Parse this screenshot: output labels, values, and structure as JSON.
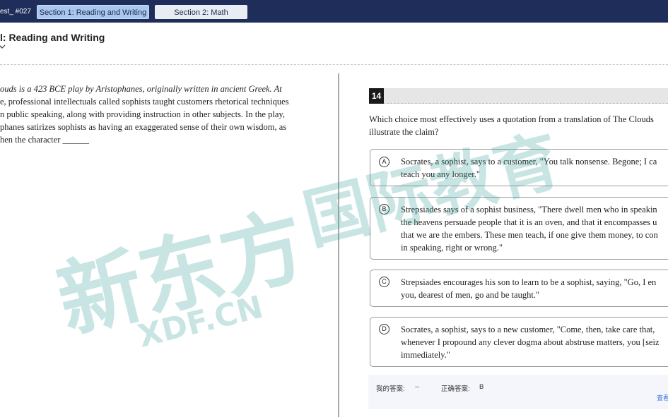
{
  "topbar": {
    "test_title": "est_ #027",
    "tabs": [
      {
        "label": "Section 1: Reading and Writing",
        "active": true
      },
      {
        "label": "Section 2: Math",
        "active": false
      }
    ]
  },
  "header": {
    "section_title": "l: Reading and Writing"
  },
  "passage": {
    "lines": [
      "ouds is a 423 BCE play by Aristophanes, originally written in ancient Greek. At",
      "e, professional intellectuals called sophists taught customers rhetorical techniques",
      "n public speaking, along with providing instruction in other subjects. In the play,",
      "phanes satirizes sophists as having an exaggerated sense of their own wisdom, as",
      "hen the character ______"
    ]
  },
  "question": {
    "number": "14",
    "lines": [
      "Which choice most effectively uses a quotation from a translation of The Clouds",
      "illustrate the claim?"
    ]
  },
  "choices": [
    {
      "letter": "A",
      "lines": [
        "Socrates, a sophist, says to a customer, \"You talk nonsense. Begone; I ca",
        "teach you any longer.\""
      ]
    },
    {
      "letter": "B",
      "lines": [
        "Strepsiades says of a sophist business, \"There dwell men who in speakin",
        "the heavens persuade people that it is an oven, and that it encompasses u",
        "that we are the embers. These men teach, if one give them money, to con",
        "in speaking, right or wrong.\""
      ]
    },
    {
      "letter": "C",
      "lines": [
        "Strepsiades encourages his son to learn to be a sophist, saying, \"Go, I en",
        "you, dearest of men, go and be taught.\""
      ]
    },
    {
      "letter": "D",
      "lines": [
        "Socrates, a sophist, says to a new customer, \"Come, then, take care that,",
        "whenever I propound any clever dogma about abstruse matters, you [seiz",
        "immediately.\""
      ]
    }
  ],
  "answer_bar": {
    "my_answer_label": "我的答案:",
    "my_answer_value": "--",
    "correct_label": "正确答案:",
    "correct_value": "B",
    "link_text": "查看"
  },
  "watermark": {
    "logo_text": "新东方",
    "site": "XDF.CN",
    "org": "国际教育"
  },
  "colors": {
    "topbar": "#1f2d5a",
    "active_tab": "#a9c7ee",
    "inactive_tab": "#e8ecf3",
    "watermark": "#3aa39e"
  }
}
